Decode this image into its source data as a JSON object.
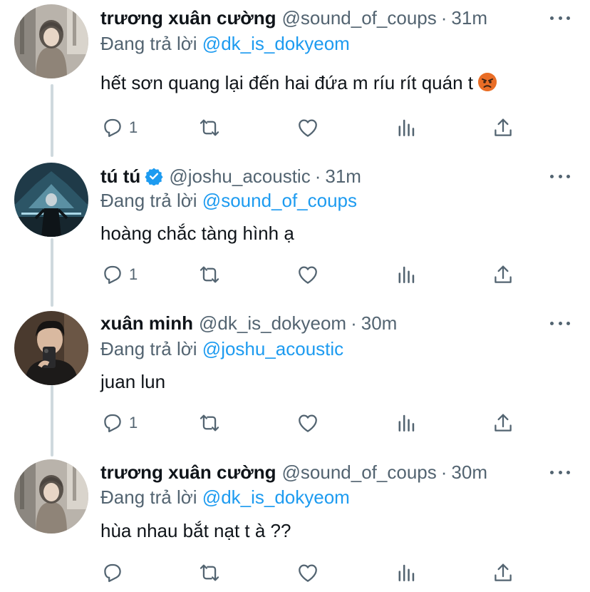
{
  "colors": {
    "accent": "#1d9bf0",
    "muted": "#536471",
    "text": "#0f1419",
    "thread_line": "#cfd9de"
  },
  "tweets": [
    {
      "name": "trương xuân cường",
      "handle": "@sound_of_coups",
      "separator": "·",
      "time": "31m",
      "verified": false,
      "reply_prefix": "Đang trả lời",
      "reply_to": "@dk_is_dokyeom",
      "text": "hết sơn quang lại đến hai đứa m ríu rít quán t",
      "emoji": "angry-face-icon",
      "reply_count": "1"
    },
    {
      "name": "tú tú",
      "handle": "@joshu_acoustic",
      "separator": "·",
      "time": "31m",
      "verified": true,
      "reply_prefix": "Đang trả lời",
      "reply_to": "@sound_of_coups",
      "text": "hoàng chắc tàng hình ạ",
      "reply_count": "1"
    },
    {
      "name": "xuân minh",
      "handle": "@dk_is_dokyeom",
      "separator": "·",
      "time": "30m",
      "verified": false,
      "reply_prefix": "Đang trả lời",
      "reply_to": "@joshu_acoustic",
      "text": "juan lun",
      "reply_count": "1"
    },
    {
      "name": "trương xuân cường",
      "handle": "@sound_of_coups",
      "separator": "·",
      "time": "30m",
      "verified": false,
      "reply_prefix": "Đang trả lời",
      "reply_to": "@dk_is_dokyeom",
      "text": "hùa nhau bắt nạt t à ??",
      "reply_count": ""
    }
  ]
}
